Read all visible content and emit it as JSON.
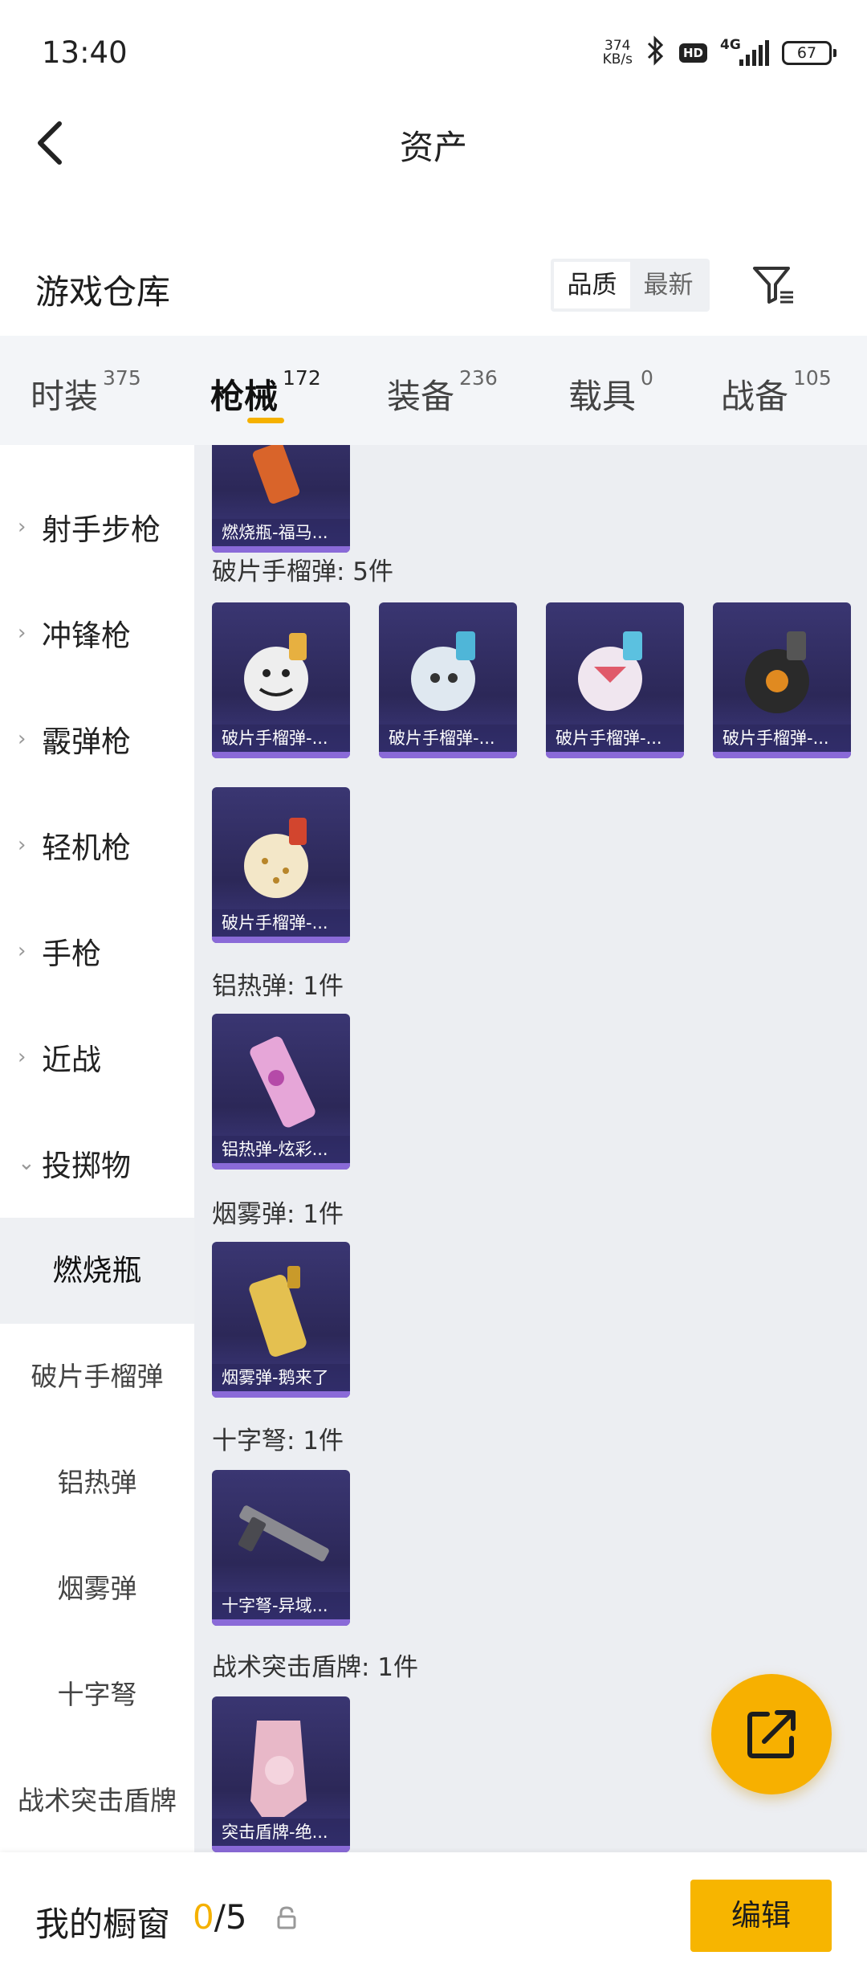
{
  "status_bar": {
    "time": "13:40",
    "net_speed_value": "374",
    "net_speed_unit": "KB/s",
    "hd_badge": "HD",
    "network": "4G",
    "battery": "67"
  },
  "header": {
    "title": "资产"
  },
  "warehouse": {
    "title": "游戏仓库",
    "sort_options": [
      "品质",
      "最新"
    ],
    "sort_selected": "品质"
  },
  "tabs": [
    {
      "label": "时装",
      "count": "375"
    },
    {
      "label": "枪械",
      "count": "172"
    },
    {
      "label": "装备",
      "count": "236"
    },
    {
      "label": "载具",
      "count": "0"
    },
    {
      "label": "战备",
      "count": "105"
    }
  ],
  "active_tab": "枪械",
  "sidebar": {
    "categories": [
      "射手步枪",
      "冲锋枪",
      "霰弹枪",
      "轻机枪",
      "手枪",
      "近战",
      "投掷物"
    ],
    "subcategories": [
      "燃烧瓶",
      "破片手榴弹",
      "铝热弹",
      "烟雾弹",
      "十字弩",
      "战术突击盾牌"
    ],
    "selected_sub": "燃烧瓶"
  },
  "content": {
    "top_partial_item": "燃烧瓶-福马...",
    "groups": [
      {
        "title": "破片手榴弹: 5件",
        "items": [
          "破片手榴弹-...",
          "破片手榴弹-...",
          "破片手榴弹-...",
          "破片手榴弹-...",
          "破片手榴弹-..."
        ]
      },
      {
        "title": "铝热弹: 1件",
        "items": [
          "铝热弹-炫彩..."
        ]
      },
      {
        "title": "烟雾弹: 1件",
        "items": [
          "烟雾弹-鹅来了"
        ]
      },
      {
        "title": "十字弩: 1件",
        "items": [
          "十字弩-异域..."
        ]
      },
      {
        "title": "战术突击盾牌: 1件",
        "items": [
          "突击盾牌-绝..."
        ]
      }
    ]
  },
  "bottom_bar": {
    "label": "我的橱窗",
    "count_current": "0",
    "count_total": "/5",
    "edit_label": "编辑"
  },
  "colors": {
    "accent": "#f7b500",
    "card_bg": "#2f2b60",
    "content_bg": "#eceef2"
  }
}
